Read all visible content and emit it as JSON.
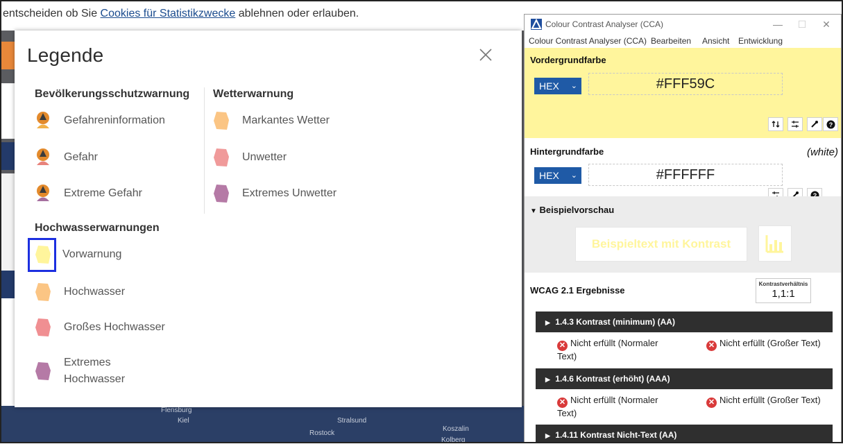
{
  "background_page": {
    "cookie_text_start": "entscheiden ob Sie ",
    "cookie_link": "Cookies für Statistikzwecke",
    "cookie_text_end": " ablehnen oder erlauben.",
    "map_labels": [
      "Flensburg",
      "Kiel",
      "Stralsund",
      "Rostock",
      "Koszalin",
      "Kolberg"
    ]
  },
  "legend": {
    "title": "Legende",
    "close_icon": "close-icon",
    "sections": {
      "civil": {
        "title": "Bevölkerungsschutzwarnung",
        "items": [
          "Gefahreninformation",
          "Gefahr",
          "Extreme Gefahr"
        ]
      },
      "weather": {
        "title": "Wetterwarnung",
        "items": [
          "Markantes Wetter",
          "Unwetter",
          "Extremes Unwetter"
        ]
      },
      "flood": {
        "title": "Hochwasserwarnungen",
        "items": [
          "Vorwarnung",
          "Hochwasser",
          "Großes Hochwasser",
          "Extremes",
          "Hochwasser"
        ]
      }
    },
    "colors": {
      "markantes": "#fbc584",
      "unwetter": "#f09a9a",
      "extremes_unwetter": "#b57aa6",
      "vorwarnung": "#fff59c",
      "hochwasser": "#fbc584",
      "grosses": "#f08f92",
      "extremes_hochwasser": "#b57aa6",
      "highlight": "#1c2fe0"
    }
  },
  "cca": {
    "title": "Colour Contrast Analyser (CCA)",
    "menu": [
      "Colour Contrast Analyser (CCA)",
      "Bearbeiten",
      "Ansicht",
      "Entwicklung"
    ],
    "foreground": {
      "title": "Vordergrundfarbe",
      "format": "HEX",
      "value": "#FFF59C",
      "color": "#fff59c"
    },
    "background": {
      "title": "Hintergrundfarbe",
      "note": "(white)",
      "format": "HEX",
      "value": "#FFFFFF"
    },
    "preview": {
      "title": "Beispielvorschau",
      "sample_text": "Beispieltext mit Kontrast"
    },
    "results": {
      "title": "WCAG 2.1 Ergebnisse",
      "ratio_label": "Kontrastverhältnis",
      "ratio_value": "1,1:1",
      "criteria": [
        {
          "label": "1.4.3 Kontrast (minimum) (AA)",
          "result_normal_1": "Nicht erfüllt (Normaler",
          "result_normal_2": "Text)",
          "result_large": "Nicht erfüllt (Großer Text)"
        },
        {
          "label": "1.4.6 Kontrast (erhöht) (AAA)",
          "result_normal_1": "Nicht erfüllt (Normaler",
          "result_normal_2": "Text)",
          "result_large": "Nicht erfüllt (Großer Text)"
        },
        {
          "label": "1.4.11 Kontrast Nicht-Text (AA)"
        }
      ]
    }
  }
}
